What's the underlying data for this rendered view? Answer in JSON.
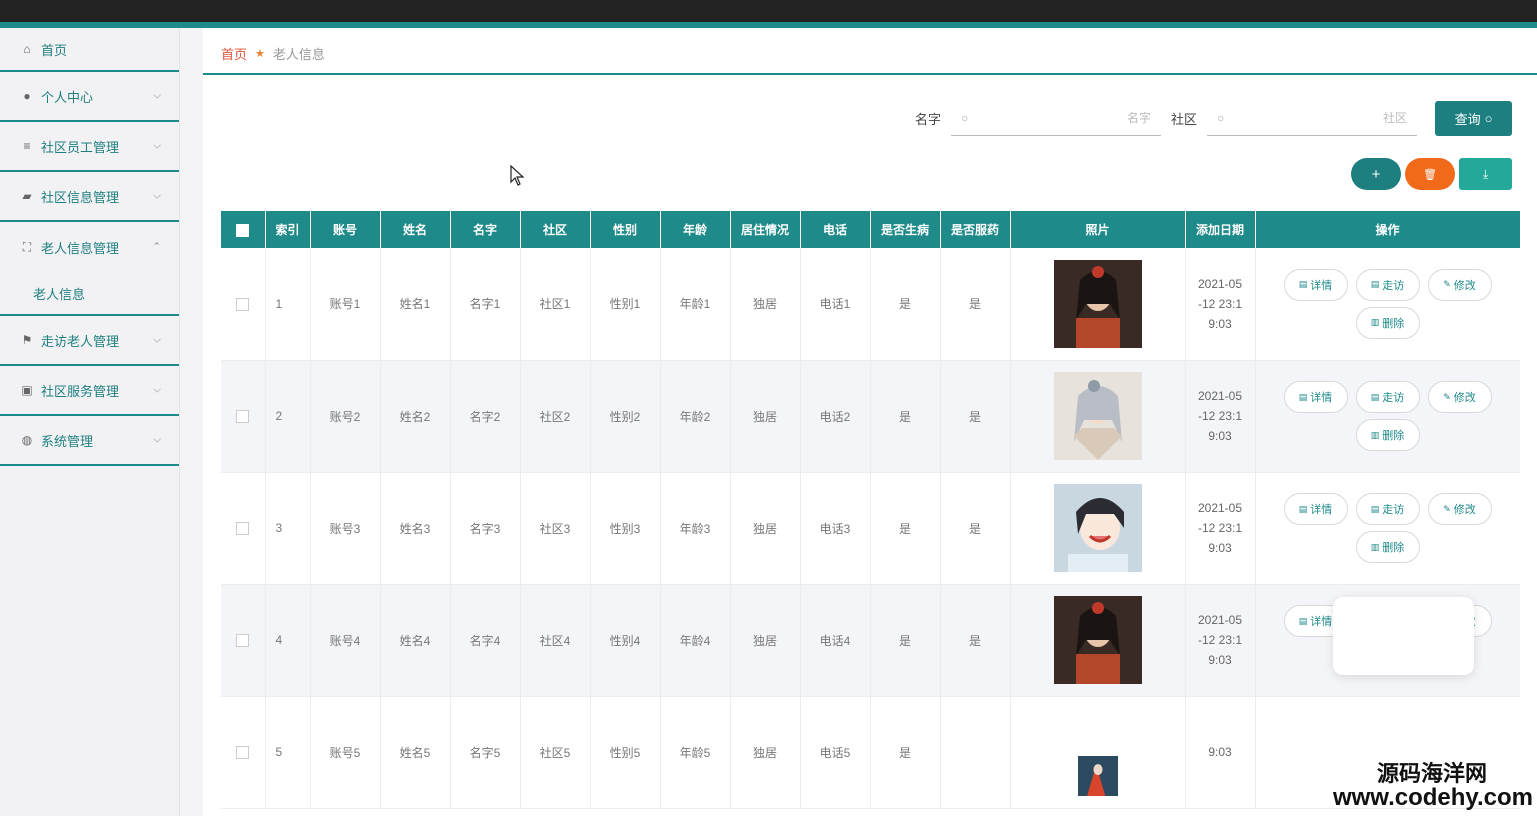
{
  "sidebar": {
    "items": [
      {
        "label": "首页",
        "icon": "home-icon",
        "glyph": "⌂",
        "chevron": ""
      },
      {
        "label": "个人中心",
        "icon": "user-icon",
        "glyph": "●",
        "chevron": "⌵"
      },
      {
        "label": "社区员工管理",
        "icon": "list-icon",
        "glyph": "≡",
        "chevron": "⌵"
      },
      {
        "label": "社区信息管理",
        "icon": "car-icon",
        "glyph": "▰",
        "chevron": "⌵"
      },
      {
        "label": "老人信息管理",
        "icon": "expand-icon",
        "glyph": "⛶",
        "chevron": "⌃"
      },
      {
        "label": "走访老人管理",
        "icon": "flag-icon",
        "glyph": "⚑",
        "chevron": "⌵"
      },
      {
        "label": "社区服务管理",
        "icon": "trash-icon",
        "glyph": "▣",
        "chevron": "⌵"
      },
      {
        "label": "系统管理",
        "icon": "mic-icon",
        "glyph": "◍",
        "chevron": "⌵"
      }
    ],
    "sub_item": "老人信息"
  },
  "breadcrumb": {
    "home": "首页",
    "current": "老人信息"
  },
  "search": {
    "name_label": "名字",
    "name_placeholder": "名字",
    "community_label": "社区",
    "community_placeholder": "社区",
    "query_label": "查询"
  },
  "actions": {
    "add": "+",
    "delete": "🗑",
    "export": "⤓"
  },
  "table": {
    "headers": [
      "索引",
      "账号",
      "姓名",
      "名字",
      "社区",
      "性别",
      "年龄",
      "居住情况",
      "电话",
      "是否生病",
      "是否服药",
      "照片",
      "添加日期",
      "操作"
    ],
    "rows": [
      {
        "idx": "1",
        "account": "账号1",
        "surname": "姓名1",
        "name": "名字1",
        "community": "社区1",
        "gender": "性别1",
        "age": "年龄1",
        "living": "独居",
        "phone": "电话1",
        "sick": "是",
        "medicine": "是",
        "date_l1": "2021-05",
        "date_l2": "-12 23:1",
        "date_l3": "9:03"
      },
      {
        "idx": "2",
        "account": "账号2",
        "surname": "姓名2",
        "name": "名字2",
        "community": "社区2",
        "gender": "性别2",
        "age": "年龄2",
        "living": "独居",
        "phone": "电话2",
        "sick": "是",
        "medicine": "是",
        "date_l1": "2021-05",
        "date_l2": "-12 23:1",
        "date_l3": "9:03"
      },
      {
        "idx": "3",
        "account": "账号3",
        "surname": "姓名3",
        "name": "名字3",
        "community": "社区3",
        "gender": "性别3",
        "age": "年龄3",
        "living": "独居",
        "phone": "电话3",
        "sick": "是",
        "medicine": "是",
        "date_l1": "2021-05",
        "date_l2": "-12 23:1",
        "date_l3": "9:03"
      },
      {
        "idx": "4",
        "account": "账号4",
        "surname": "姓名4",
        "name": "名字4",
        "community": "社区4",
        "gender": "性别4",
        "age": "年龄4",
        "living": "独居",
        "phone": "电话4",
        "sick": "是",
        "medicine": "是",
        "date_l1": "2021-05",
        "date_l2": "-12 23:1",
        "date_l3": "9:03"
      },
      {
        "idx": "5",
        "account": "账号5",
        "surname": "姓名5",
        "name": "名字5",
        "community": "社区5",
        "gender": "性别5",
        "age": "年龄5",
        "living": "独居",
        "phone": "电话5",
        "sick": "是",
        "medicine": "",
        "date_l1": "",
        "date_l2": "",
        "date_l3": "9:03"
      }
    ],
    "ops": {
      "detail": "详情",
      "visit": "走访",
      "edit": "修改",
      "delete": "删除"
    }
  },
  "watermark": {
    "line1": "源码海洋网",
    "line2": "www.codehy.com"
  },
  "colors": {
    "accent": "#1e8a8a",
    "danger": "#f06a1a",
    "home": "#e0533b"
  }
}
